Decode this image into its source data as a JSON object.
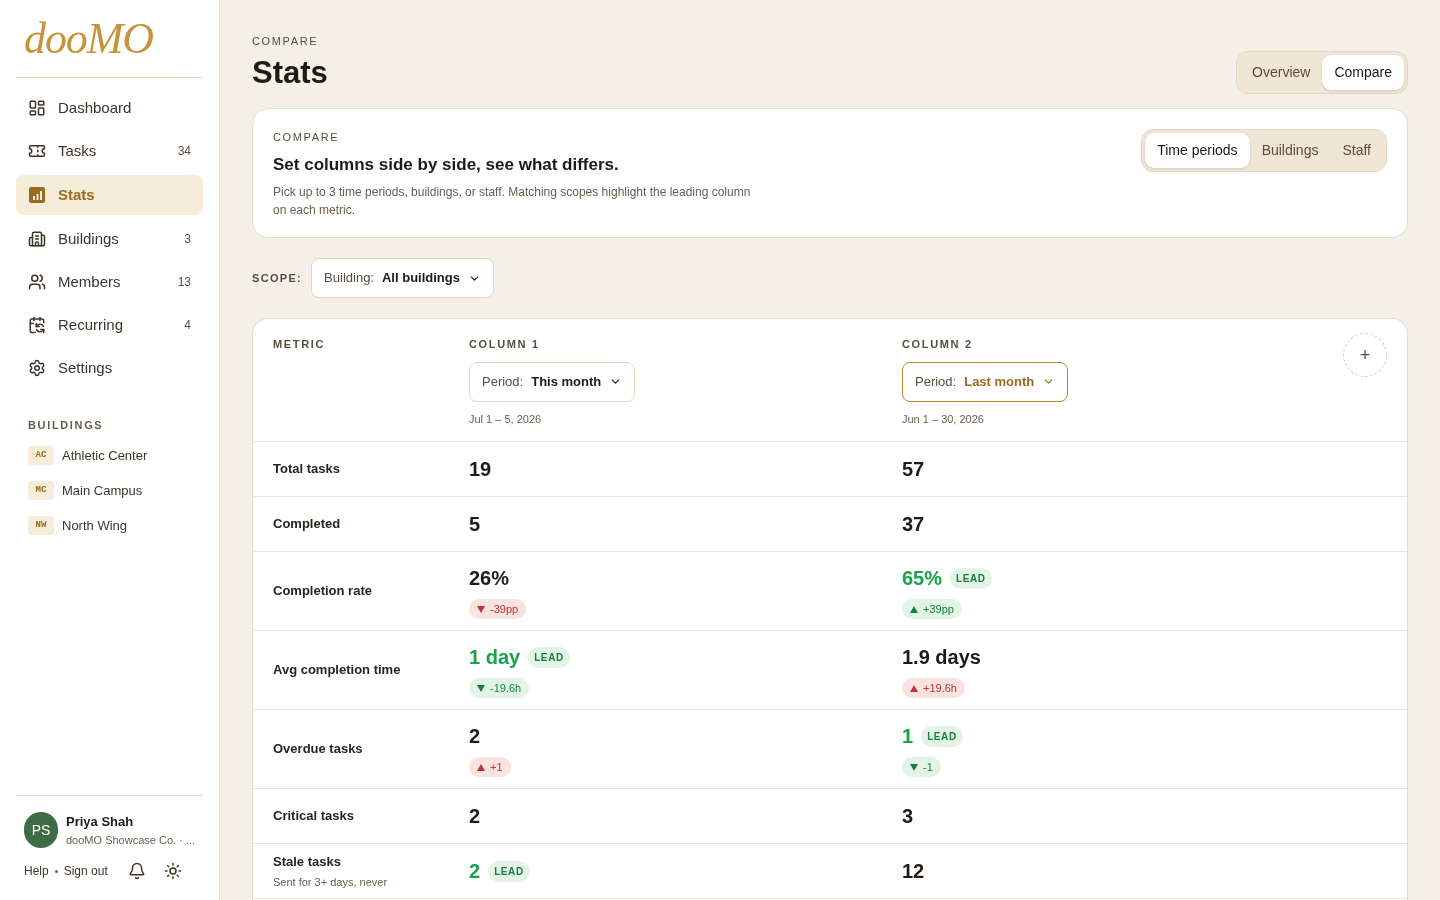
{
  "sidebar": {
    "logo": "dooMO",
    "nav": [
      {
        "label": "Dashboard",
        "selected": false
      },
      {
        "label": "Tasks",
        "count": "34",
        "selected": false
      },
      {
        "label": "Stats",
        "selected": true
      },
      {
        "label": "Buildings",
        "count": "3",
        "selected": false
      },
      {
        "label": "Members",
        "count": "13",
        "selected": false
      },
      {
        "label": "Recurring",
        "count": "4",
        "selected": false
      },
      {
        "label": "Settings",
        "selected": false
      }
    ],
    "buildings_heading": "BUILDINGS",
    "buildings": [
      {
        "code": "AC",
        "name": "Athletic Center"
      },
      {
        "code": "MC",
        "name": "Main Campus"
      },
      {
        "code": "NW",
        "name": "North Wing"
      }
    ],
    "user": {
      "initials": "PS",
      "name": "Priya Shah",
      "org": "dooMO Showcase Co. · ..."
    },
    "footer_links": [
      "Help",
      "Sign out"
    ]
  },
  "header": {
    "eyebrow": "COMPARE",
    "title": "Stats",
    "tabs": [
      {
        "label": "Overview",
        "selected": false
      },
      {
        "label": "Compare",
        "selected": true
      }
    ]
  },
  "intro": {
    "eyebrow": "COMPARE",
    "title": "Set columns side by side, see what differs.",
    "text": "Pick up to 3 time periods, buildings, or staff. Matching scopes highlight the leading column on each metric.",
    "modes": [
      {
        "label": "Time periods",
        "selected": true
      },
      {
        "label": "Buildings",
        "selected": false
      },
      {
        "label": "Staff",
        "selected": false
      }
    ]
  },
  "scope": {
    "label": "SCOPE:",
    "field": "Building:",
    "value": "All buildings"
  },
  "table": {
    "metric_heading": "METRIC",
    "columns": [
      {
        "heading": "COLUMN 1",
        "field": "Period:",
        "value": "This month",
        "range": "Jul 1 – 5, 2026",
        "highlighted": false
      },
      {
        "heading": "COLUMN 2",
        "field": "Period:",
        "value": "Last month",
        "range": "Jun 1 – 30, 2026",
        "highlighted": true
      }
    ],
    "add_button": "+",
    "rows": [
      {
        "label": "Total tasks",
        "cells": [
          {
            "value": "19",
            "lead": false
          },
          {
            "value": "57",
            "lead": false
          }
        ]
      },
      {
        "label": "Completed",
        "cells": [
          {
            "value": "5",
            "lead": false
          },
          {
            "value": "37",
            "lead": false
          }
        ]
      },
      {
        "label": "Completion rate",
        "cells": [
          {
            "value": "26%",
            "lead": false,
            "delta": {
              "text": "-39pp",
              "up": false,
              "good": false
            }
          },
          {
            "value": "65%",
            "lead": true,
            "badge": "LEAD",
            "delta": {
              "text": "+39pp",
              "up": true,
              "good": true
            }
          }
        ]
      },
      {
        "label": "Avg completion time",
        "cells": [
          {
            "value": "1 day",
            "lead": true,
            "badge": "LEAD",
            "delta": {
              "text": "-19.6h",
              "up": false,
              "good": true
            }
          },
          {
            "value": "1.9 days",
            "lead": false,
            "delta": {
              "text": "+19.6h",
              "up": true,
              "good": false
            }
          }
        ]
      },
      {
        "label": "Overdue tasks",
        "cells": [
          {
            "value": "2",
            "lead": false,
            "delta": {
              "text": "+1",
              "up": true,
              "good": false
            }
          },
          {
            "value": "1",
            "lead": true,
            "badge": "LEAD",
            "delta": {
              "text": "-1",
              "up": false,
              "good": true
            }
          }
        ]
      },
      {
        "label": "Critical tasks",
        "cells": [
          {
            "value": "2",
            "lead": false
          },
          {
            "value": "3",
            "lead": false
          }
        ]
      },
      {
        "label": "Stale tasks",
        "sub": "Sent for 3+ days, never",
        "cells": [
          {
            "value": "2",
            "lead": true,
            "badge": "LEAD"
          },
          {
            "value": "12",
            "lead": false
          }
        ]
      }
    ]
  }
}
